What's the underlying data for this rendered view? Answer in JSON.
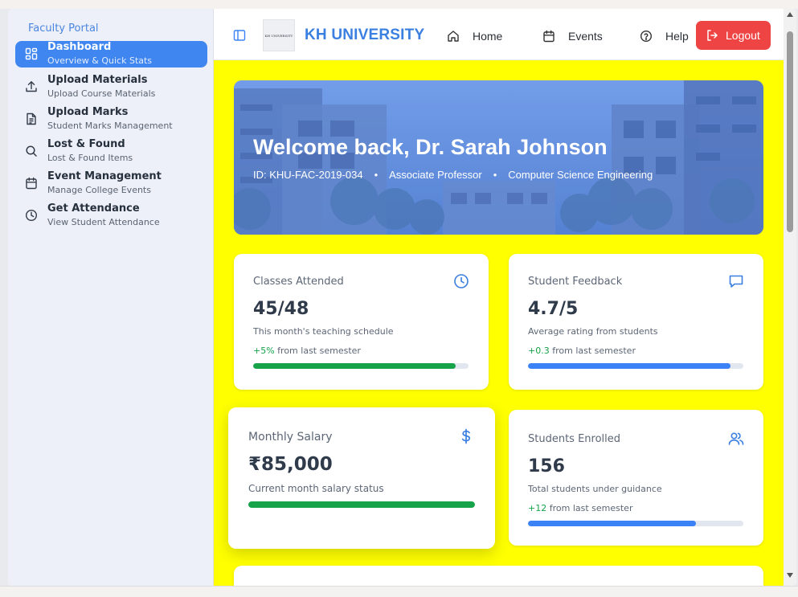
{
  "sidebar": {
    "title": "Faculty Portal",
    "items": [
      {
        "label": "Dashboard",
        "sub": "Overview & Quick Stats",
        "icon": "dashboard-grid-icon",
        "active": true
      },
      {
        "label": "Upload Materials",
        "sub": "Upload Course Materials",
        "icon": "upload-icon"
      },
      {
        "label": "Upload Marks",
        "sub": "Student Marks Management",
        "icon": "document-icon"
      },
      {
        "label": "Lost & Found",
        "sub": "Lost & Found Items",
        "icon": "search-icon"
      },
      {
        "label": "Event Management",
        "sub": "Manage College Events",
        "icon": "calendar-icon"
      },
      {
        "label": "Get Attendance",
        "sub": "View Student Attendance",
        "icon": "clock-icon"
      }
    ]
  },
  "header": {
    "logo_text": "KH UNIVERSITY",
    "brand": "KH UNIVERSITY",
    "nav": [
      {
        "label": "Home",
        "icon": "home-icon"
      },
      {
        "label": "Events",
        "icon": "calendar-icon"
      },
      {
        "label": "Help",
        "icon": "help-circle-icon"
      }
    ],
    "logout_label": "Logout"
  },
  "hero": {
    "title": "Welcome back, Dr. Sarah Johnson",
    "id": "ID: KHU-FAC-2019-034",
    "role": "Associate Professor",
    "department": "Computer Science Engineering",
    "separator": "•"
  },
  "stats": [
    {
      "title": "Classes Attended",
      "icon": "clock-icon",
      "value": "45/48",
      "desc": "This month's teaching schedule",
      "change": "+5%",
      "change_suffix": "from last semester",
      "progress": 0.94,
      "bar_color": "#16a34a"
    },
    {
      "title": "Student Feedback",
      "icon": "message-icon",
      "value": "4.7/5",
      "desc": "Average rating from students",
      "change": "+0.3",
      "change_suffix": "from last semester",
      "progress": 0.94,
      "bar_color": "#3b82f6"
    },
    {
      "title": "Monthly Salary",
      "icon": "dollar-icon",
      "value": "₹85,000",
      "desc": "Current month salary status",
      "progress": 1.0,
      "bar_color": "#16a34a"
    },
    {
      "title": "Students Enrolled",
      "icon": "users-icon",
      "value": "156",
      "desc": "Total students under guidance",
      "change": "+12",
      "change_suffix": "from last semester",
      "progress": 0.78,
      "bar_color": "#3b82f6"
    }
  ],
  "colors": {
    "accent": "#3f86f0",
    "main_bg": "#ffff00",
    "logout": "#ef4444",
    "success": "#16a34a"
  }
}
